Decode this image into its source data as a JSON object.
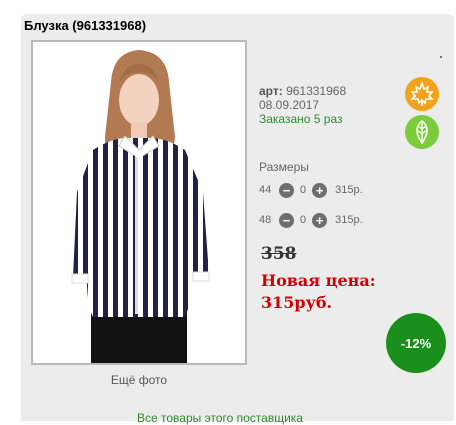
{
  "product": {
    "title": "Блузка (961331968)",
    "article_label": "арт:",
    "article": "961331968",
    "date": "08.09.2017",
    "ordered": "Заказано 5 раз"
  },
  "photo": {
    "more_label": "Ещё фото"
  },
  "sizes": {
    "header": "Размеры",
    "rows": [
      {
        "size": "44",
        "qty": "0",
        "price": "315р."
      },
      {
        "size": "48",
        "qty": "0",
        "price": "315р."
      }
    ]
  },
  "pricing": {
    "old_price": "358",
    "new_price_line1": "Новая цена:",
    "new_price_line2": "315руб.",
    "discount": "-12%"
  },
  "links": {
    "supplier": "Все товары этого поставщика"
  },
  "colors": {
    "accent_green": "#1b8f1b",
    "price_red": "#d40000",
    "badge_orange": "#f2a31a",
    "badge_green": "#7ccb3a"
  },
  "icons": {
    "season_autumn": "maple-leaf-icon",
    "season_spring": "leaf-icon"
  }
}
